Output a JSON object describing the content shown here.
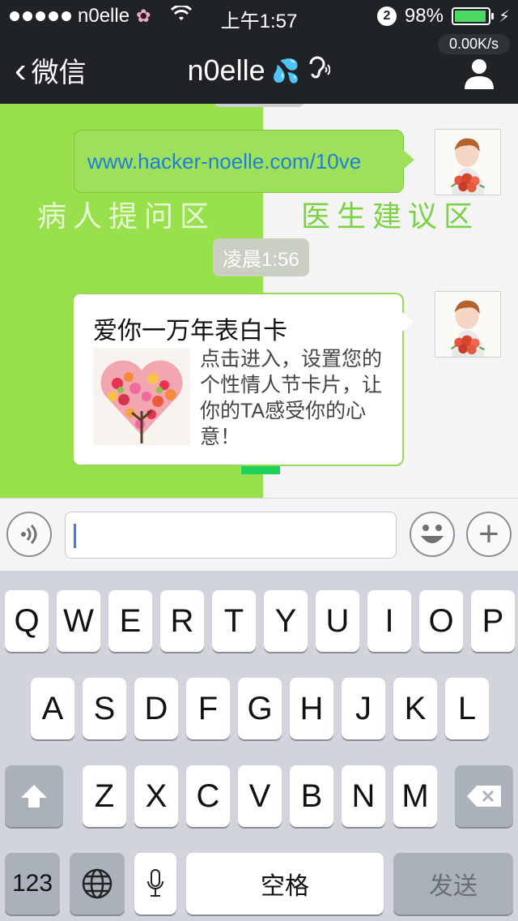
{
  "status_bar": {
    "carrier": "n0elle",
    "time": "上午1:57",
    "notification_count": "2",
    "battery_percent": "98%"
  },
  "nav": {
    "back_label": "微信",
    "title": "n0elle",
    "net_speed": "0.00K/s"
  },
  "chat": {
    "watermark_left": "病人提问区",
    "watermark_right": "医生建议区",
    "messages": [
      {
        "type": "link",
        "text": "www.hacker-noelle.com/10ve"
      },
      {
        "type": "timestamp",
        "text": "凌晨1:56"
      },
      {
        "type": "card",
        "title": "爱你一万年表白卡",
        "description": "点击进入，设置您的个性情人节卡片，让你的TA感受你的心意！"
      }
    ]
  },
  "input_bar": {
    "text_value": ""
  },
  "keyboard": {
    "row1": [
      "Q",
      "W",
      "E",
      "R",
      "T",
      "Y",
      "U",
      "I",
      "O",
      "P"
    ],
    "row2": [
      "A",
      "S",
      "D",
      "F",
      "G",
      "H",
      "J",
      "K",
      "L"
    ],
    "row3": [
      "Z",
      "X",
      "C",
      "V",
      "B",
      "N",
      "M"
    ],
    "numbers_label": "123",
    "space_label": "空格",
    "send_label": "发送"
  },
  "colors": {
    "accent_green": "#98e04c",
    "link_blue": "#1e7fd8",
    "battery_green": "#4cd964"
  }
}
